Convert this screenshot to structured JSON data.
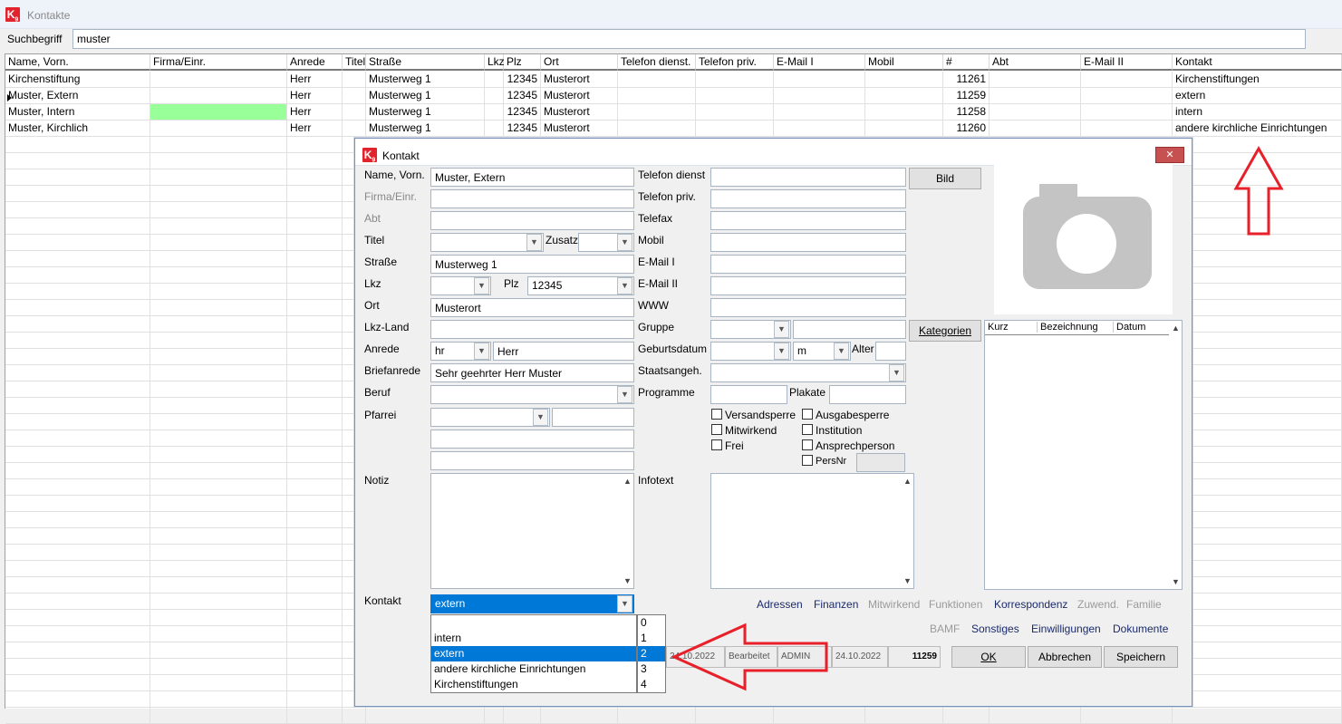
{
  "app": {
    "title": "Kontakte",
    "logo_text": "K9",
    "search_label": "Suchbegriff",
    "search_value": "muster"
  },
  "grid": {
    "columns": [
      "Name, Vorn.",
      "Firma/Einr.",
      "Anrede",
      "Titel",
      "Straße",
      "Lkz",
      "Plz",
      "Ort",
      "Telefon dienst.",
      "Telefon priv.",
      "E-Mail I",
      "Mobil",
      "#",
      "Abt",
      "E-Mail II",
      "Kontakt"
    ],
    "rows": [
      {
        "name": "Kirchenstiftung",
        "firma": "",
        "anrede": "Herr",
        "titel": "",
        "strasse": "Musterweg 1",
        "lkz": "",
        "plz": "12345",
        "ort": "Musterort",
        "nr": "11261",
        "kontakt": "Kirchenstiftungen"
      },
      {
        "name": "Muster, Extern",
        "firma": "",
        "anrede": "Herr",
        "titel": "",
        "strasse": "Musterweg 1",
        "lkz": "",
        "plz": "12345",
        "ort": "Musterort",
        "nr": "11259",
        "kontakt": "extern"
      },
      {
        "name": "Muster, Intern",
        "firma": "",
        "anrede": "Herr",
        "titel": "",
        "strasse": "Musterweg 1",
        "lkz": "",
        "plz": "12345",
        "ort": "Musterort",
        "nr": "11258",
        "kontakt": "intern"
      },
      {
        "name": "Muster, Kirchlich",
        "firma": "",
        "anrede": "Herr",
        "titel": "",
        "strasse": "Musterweg 1",
        "lkz": "",
        "plz": "12345",
        "ort": "Musterort",
        "nr": "11260",
        "kontakt": "andere kirchliche Einrichtungen"
      }
    ],
    "highlight_color": "#99ff99"
  },
  "dialog": {
    "title": "Kontakt",
    "close_glyph": "✕",
    "labels": {
      "name": "Name, Vorn.",
      "firma": "Firma/Einr.",
      "abt": "Abt",
      "titel": "Titel",
      "zusatz": "Zusatz",
      "strasse": "Straße",
      "lkz": "Lkz",
      "plz": "Plz",
      "ort": "Ort",
      "lkz_land": "Lkz-Land",
      "anrede": "Anrede",
      "briefanrede": "Briefanrede",
      "beruf": "Beruf",
      "pfarrei": "Pfarrei",
      "notiz": "Notiz",
      "kontakt": "Kontakt",
      "tel_dienst": "Telefon dienst",
      "tel_priv": "Telefon priv.",
      "telefax": "Telefax",
      "mobil": "Mobil",
      "email1": "E-Mail I",
      "email2": "E-Mail II",
      "www": "WWW",
      "gruppe": "Gruppe",
      "geburtsdatum": "Geburtsdatum",
      "alter": "Alter",
      "staatsangeh": "Staatsangeh.",
      "programme": "Programme",
      "plakate": "Plakate",
      "infotext": "Infotext"
    },
    "values": {
      "name": "Muster, Extern",
      "strasse": "Musterweg 1",
      "plz": "12345",
      "ort": "Musterort",
      "anrede_code": "hr",
      "anrede": "Herr",
      "briefanrede": "Sehr geehrter Herr Muster",
      "geschlecht": "m",
      "kontakt": "extern"
    },
    "checkboxes": {
      "versandsperre": "Versandsperre",
      "ausgabesperre": "Ausgabesperre",
      "mitwirkend": "Mitwirkend",
      "institution": "Institution",
      "frei": "Frei",
      "ansprechperson": "Ansprechperson",
      "persnr": "PersNr"
    },
    "buttons": {
      "bild": "Bild",
      "kategorien": "Kategorien",
      "ok": "OK",
      "abbrechen": "Abbrechen",
      "speichern": "Speichern"
    },
    "kategorien_columns": [
      "Kurz",
      "Bezeichnung",
      "Datum"
    ],
    "links_row1": [
      {
        "label": "Adressen",
        "enabled": true
      },
      {
        "label": "Finanzen",
        "enabled": true
      },
      {
        "label": "Mitwirkend",
        "enabled": false
      },
      {
        "label": "Funktionen",
        "enabled": false
      },
      {
        "label": "Korrespondenz",
        "enabled": true
      },
      {
        "label": "Zuwend.",
        "enabled": false
      },
      {
        "label": "Familie",
        "enabled": false
      }
    ],
    "links_row2": [
      {
        "label": "BAMF",
        "enabled": false
      },
      {
        "label": "Sonstiges",
        "enabled": true
      },
      {
        "label": "Einwilligungen",
        "enabled": true
      },
      {
        "label": "Dokumente",
        "enabled": true
      }
    ],
    "status": {
      "date1": "24.10.2022",
      "state": "Bearbeitet",
      "user": "ADMIN",
      "date2": "24.10.2022",
      "id": "11259"
    },
    "kontakt_options": [
      {
        "label": "",
        "code": "0"
      },
      {
        "label": "intern",
        "code": "1"
      },
      {
        "label": "extern",
        "code": "2",
        "selected": true
      },
      {
        "label": "andere kirchliche Einrichtungen",
        "code": "3"
      },
      {
        "label": "Kirchenstiftungen",
        "code": "4"
      }
    ]
  },
  "colors": {
    "selection": "#0078d7",
    "arrow": "#e8202a",
    "camera": "#c4c4c4"
  },
  "icons": {
    "camera": "camera-icon",
    "arrow_up": "arrow-up-icon",
    "arrow_left": "arrow-left-icon",
    "dropdown": "chevron-down-icon"
  }
}
